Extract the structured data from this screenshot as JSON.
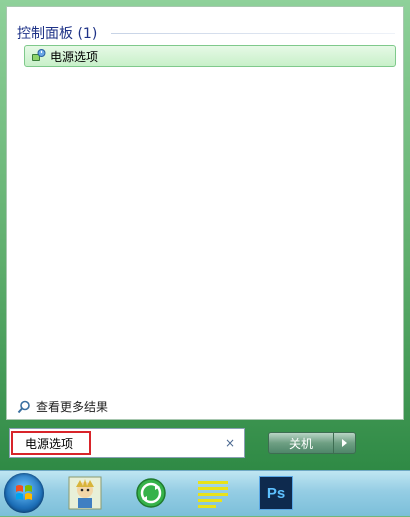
{
  "results": {
    "group_header": "控制面板 (1)",
    "items": [
      {
        "label": "电源选项",
        "icon": "power-options-icon"
      }
    ],
    "see_more": "查看更多结果"
  },
  "search": {
    "value": "电源选项",
    "clear_glyph": "×"
  },
  "shutdown": {
    "label": "关机"
  },
  "taskbar": {
    "items": [
      "start-orb-icon",
      "game-character-icon",
      "refresh-green-icon",
      "notes-yellow-icon",
      "photoshop-icon"
    ],
    "photoshop_label": "Ps"
  },
  "colors": {
    "frame_green": "#5fae6d",
    "highlight_green": "#c8f0c9",
    "search_outline_red": "#d8242a",
    "taskbar_blue": "#95cde4"
  }
}
